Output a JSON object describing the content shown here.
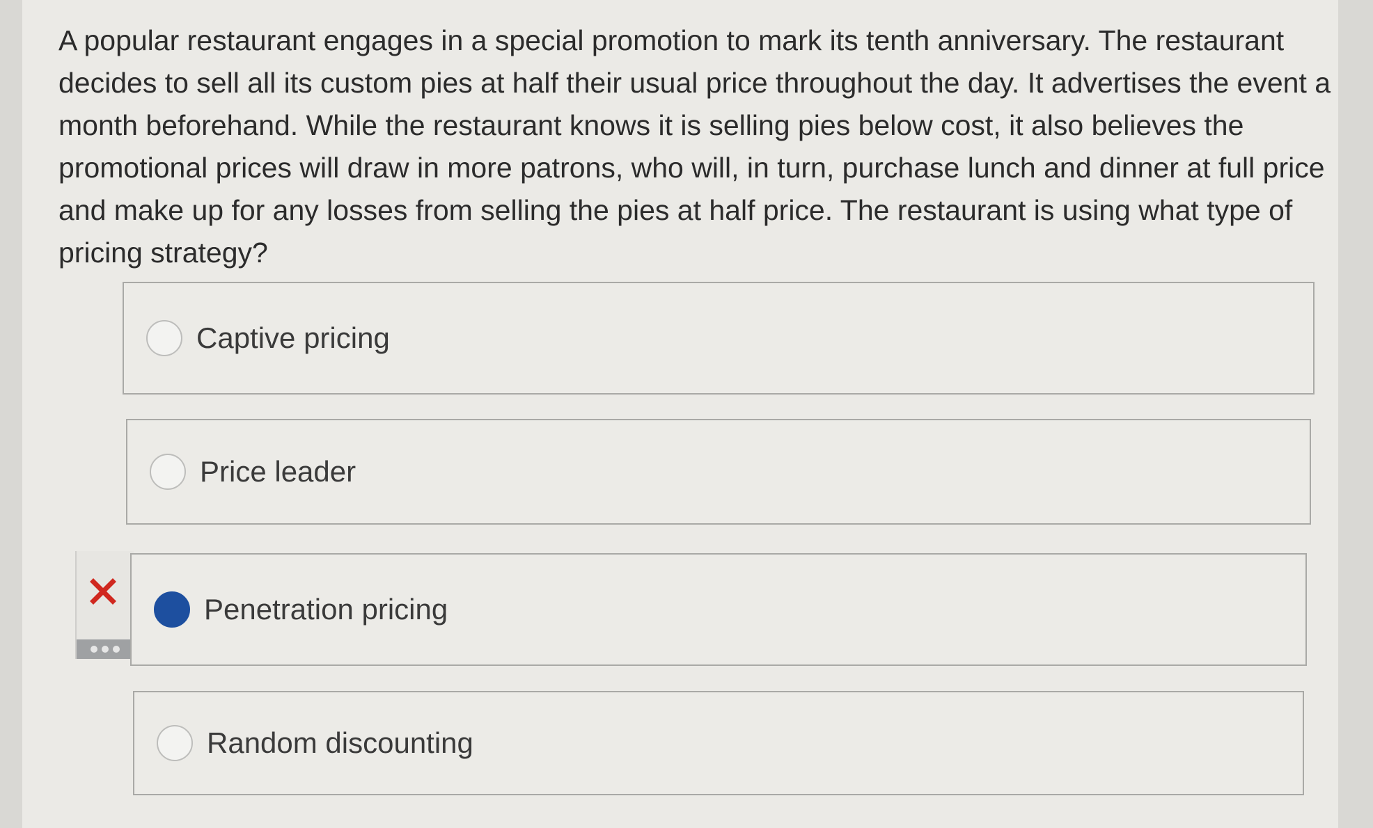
{
  "question": {
    "text": "A popular restaurant engages in a special promotion to mark its tenth anniversary. The restaurant decides to sell all its custom pies at half their usual price throughout the day. It advertises the event a month beforehand. While the restaurant knows it is selling pies below cost, it also believes the promotional prices will draw in more patrons, who will, in turn, purchase lunch and dinner at full price and make up for any losses from selling the pies at half price. The restaurant is using what type of pricing strategy?"
  },
  "choices": [
    {
      "label": "Captive pricing",
      "selected": false
    },
    {
      "label": "Price leader",
      "selected": false
    },
    {
      "label": "Penetration pricing",
      "selected": true
    },
    {
      "label": "Random discounting",
      "selected": false
    }
  ],
  "feedback": {
    "icon": "x-mark-icon",
    "color": "#d0281f"
  },
  "colors": {
    "selected_radio": "#1d4f9f",
    "background": "#ebeae6"
  }
}
